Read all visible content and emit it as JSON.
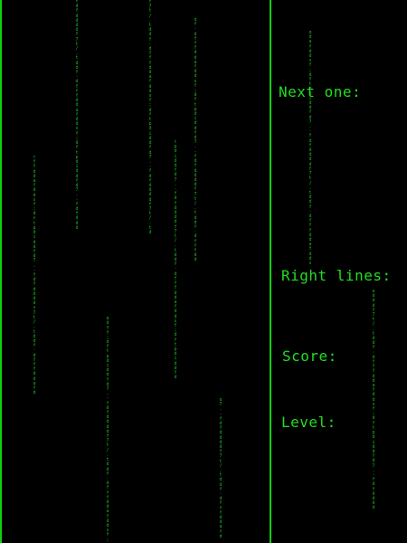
{
  "game": {
    "hud": {
      "next_label": "Next one:",
      "lines_label": "Right lines:",
      "score_label": "Score:",
      "level_label": "Level:"
    }
  },
  "colors": {
    "background": "#000000",
    "wall": "#11d011",
    "text": "#22dd22",
    "rain": "#1fb81f"
  },
  "rain_glyphs": "ftdfdfdfdfdftdfd7fdpsdftd7dfd·/d.i;ad.d-ddf"
}
